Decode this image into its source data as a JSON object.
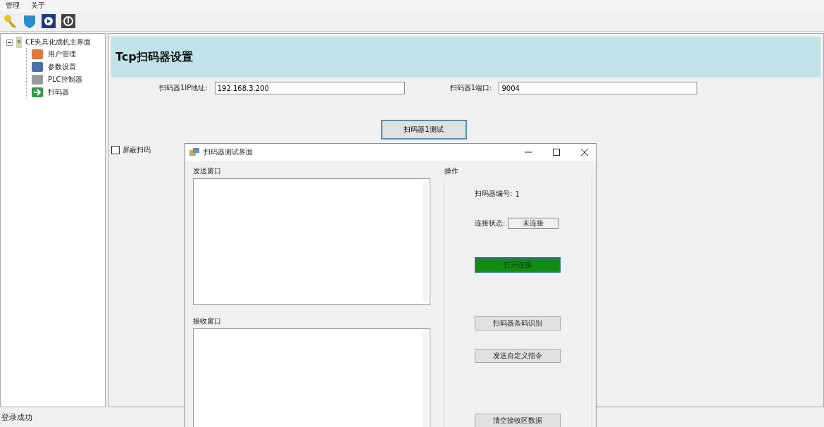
{
  "menu": [
    "管理",
    "关于"
  ],
  "tree": {
    "label": "CE夹具化成机主界面",
    "expanded": true,
    "children": [
      {
        "label": "用户管理",
        "kind": "users"
      },
      {
        "label": "参数设置",
        "kind": "params"
      },
      {
        "label": "PLC控制器",
        "kind": "plc"
      },
      {
        "label": "扫码器",
        "kind": "scanner"
      }
    ]
  },
  "header": {
    "title": "Tcp扫码器设置"
  },
  "fields": [
    {
      "label": "扫码器1IP地址:",
      "value": "192.168.3.200"
    },
    {
      "label": "扫码器1端口:",
      "value": "9004"
    }
  ],
  "test_button": "扫码器1测试",
  "mask_checkbox": {
    "label": "屏蔽扫码",
    "checked": false
  },
  "dialog": {
    "title": "扫码器测试界面",
    "send_group": "发送窗口",
    "receive_group": "接收窗口",
    "ops": {
      "title": "操作",
      "number_label": "扫码器编号:",
      "number": "1",
      "status_label": "连接状态:",
      "status": "未连接",
      "buttons": [
        {
          "label": "打开连接",
          "kind": "primary"
        },
        {
          "label": "扫码器条码识别",
          "kind": "normal"
        },
        {
          "label": "发送自定义指令",
          "kind": "normal"
        },
        {
          "label": "清空接收区数据",
          "kind": "normal"
        }
      ]
    }
  },
  "status_bar": "登录成功"
}
